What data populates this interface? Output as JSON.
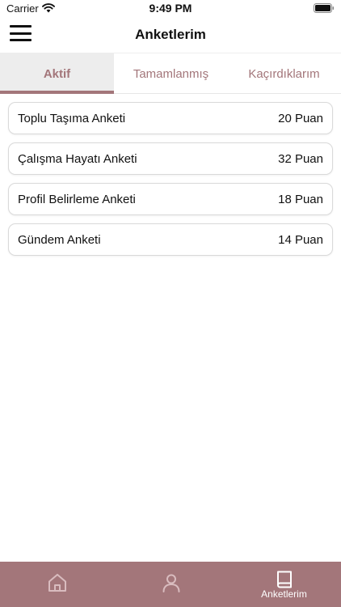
{
  "status_bar": {
    "carrier": "Carrier",
    "time": "9:49 PM"
  },
  "header": {
    "title": "Anketlerim"
  },
  "tabs": [
    {
      "label": "Aktif",
      "active": true
    },
    {
      "label": "Tamamlanmış",
      "active": false
    },
    {
      "label": "Kaçırdıklarım",
      "active": false
    }
  ],
  "surveys": [
    {
      "name": "Toplu Taşıma Anketi",
      "points": "20 Puan"
    },
    {
      "name": "Çalışma Hayatı Anketi",
      "points": "32 Puan"
    },
    {
      "name": "Profil Belirleme Anketi",
      "points": "18 Puan"
    },
    {
      "name": "Gündem Anketi",
      "points": "14 Puan"
    }
  ],
  "bottom_tabs": [
    {
      "icon": "home-icon",
      "label": ""
    },
    {
      "icon": "person-icon",
      "label": ""
    },
    {
      "icon": "book-icon",
      "label": "Anketlerim",
      "selected": true
    }
  ],
  "colors": {
    "accent": "#a3767a",
    "tab_active_bg": "#ededed",
    "card_border": "#d9d9d9"
  }
}
